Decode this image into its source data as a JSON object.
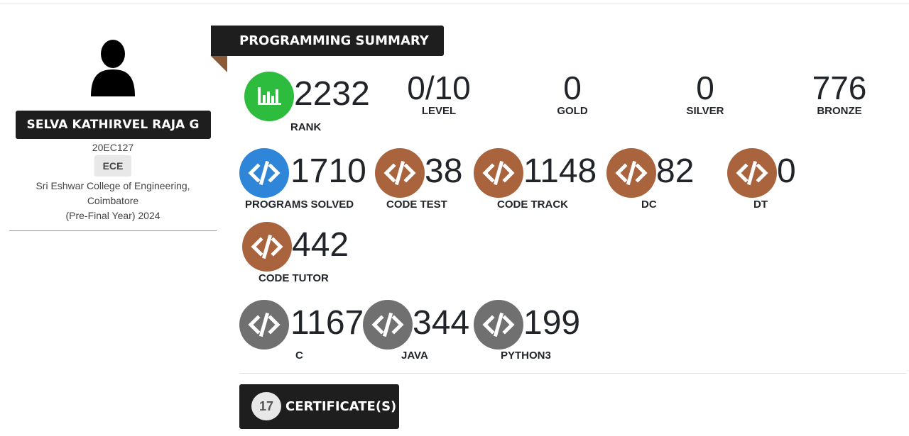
{
  "profile": {
    "name": "SELVA KATHIRVEL RAJA G",
    "roll_no": "20EC127",
    "department": "ECE",
    "college_line1": "Sri Eshwar College of Engineering,",
    "college_line2": "Coimbatore",
    "year_line": "(Pre-Final Year) 2024",
    "avatar_icon": "user-silhouette-icon"
  },
  "summary": {
    "title": "PROGRAMMING SUMMARY",
    "rank": {
      "value": "2232",
      "label": "RANK",
      "icon": "bar-chart-icon",
      "color": "#2ebc3f"
    },
    "stats": [
      {
        "value": "0/10",
        "label": "LEVEL"
      },
      {
        "value": "0",
        "label": "GOLD"
      },
      {
        "value": "0",
        "label": "SILVER"
      },
      {
        "value": "776",
        "label": "BRONZE"
      }
    ],
    "tracks": [
      {
        "value": "1710",
        "label": "PROGRAMS SOLVED",
        "icon": "code-icon",
        "color": "#2f86d8"
      },
      {
        "value": "38",
        "label": "CODE TEST",
        "icon": "code-icon",
        "color": "#a9633d"
      },
      {
        "value": "1148",
        "label": "CODE TRACK",
        "icon": "code-icon",
        "color": "#a9633d"
      },
      {
        "value": "82",
        "label": "DC",
        "icon": "code-icon",
        "color": "#a9633d"
      },
      {
        "value": "0",
        "label": "DT",
        "icon": "code-icon",
        "color": "#a9633d"
      },
      {
        "value": "442",
        "label": "CODE TUTOR",
        "icon": "code-icon",
        "color": "#a9633d"
      }
    ],
    "languages": [
      {
        "value": "1167",
        "label": "C",
        "icon": "code-icon",
        "color": "#707070"
      },
      {
        "value": "344",
        "label": "JAVA",
        "icon": "code-icon",
        "color": "#707070"
      },
      {
        "value": "199",
        "label": "PYTHON3",
        "icon": "code-icon",
        "color": "#707070"
      }
    ]
  },
  "certificates": {
    "count": "17",
    "label": "CERTIFICATE(S)"
  }
}
